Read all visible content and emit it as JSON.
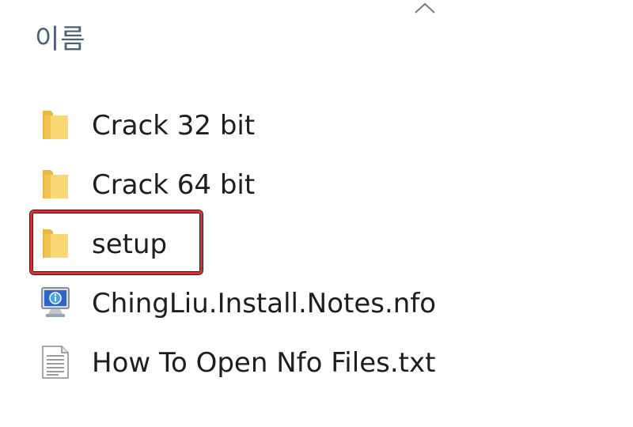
{
  "header": {
    "column_name": "이름"
  },
  "files": [
    {
      "name": "Crack 32 bit",
      "type": "folder",
      "icon": "folder-icon"
    },
    {
      "name": "Crack 64 bit",
      "type": "folder",
      "icon": "folder-icon"
    },
    {
      "name": "setup",
      "type": "folder",
      "icon": "folder-icon",
      "highlighted": true
    },
    {
      "name": "ChingLiu.Install.Notes.nfo",
      "type": "nfo",
      "icon": "nfo-file-icon"
    },
    {
      "name": "How To Open Nfo Files.txt",
      "type": "txt",
      "icon": "text-file-icon"
    }
  ],
  "colors": {
    "highlight_border": "#d72f36",
    "header_text": "#4c607a",
    "folder_yellow": "#f4cf62"
  }
}
